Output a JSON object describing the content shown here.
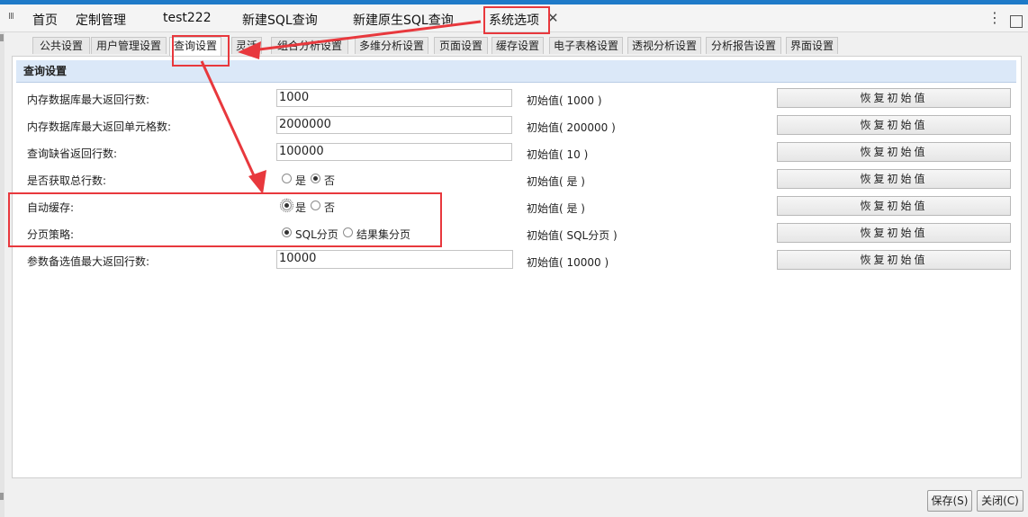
{
  "tabs": [
    {
      "label": "首页"
    },
    {
      "label": "定制管理"
    },
    {
      "label": "test222"
    },
    {
      "label": "新建SQL查询"
    },
    {
      "label": "新建原生SQL查询"
    },
    {
      "label": "系统选项",
      "close": "✕"
    }
  ],
  "window": {
    "grip": "III",
    "more": "⋮"
  },
  "subtabs": [
    {
      "label": "公共设置"
    },
    {
      "label": "用户管理设置"
    },
    {
      "label": "查询设置"
    },
    {
      "label": "灵活"
    },
    {
      "label": "组合分析设置"
    },
    {
      "label": "多维分析设置"
    },
    {
      "label": "页面设置"
    },
    {
      "label": "缓存设置"
    },
    {
      "label": "电子表格设置"
    },
    {
      "label": "透视分析设置"
    },
    {
      "label": "分析报告设置"
    },
    {
      "label": "界面设置"
    }
  ],
  "panel": {
    "title": "查询设置"
  },
  "settings": [
    {
      "label": "内存数据库最大返回行数:",
      "value": "1000",
      "initial": "初始值( 1000 )",
      "reset": "恢复初始值"
    },
    {
      "label": "内存数据库最大返回单元格数:",
      "value": "2000000",
      "initial": "初始值( 200000 )",
      "reset": "恢复初始值"
    },
    {
      "label": "查询缺省返回行数:",
      "value": "100000",
      "initial": "初始值( 10 )",
      "reset": "恢复初始值"
    },
    {
      "label": "是否获取总行数:",
      "opt1": "是",
      "opt2": "否",
      "selected": "否",
      "initial": "初始值( 是 )",
      "reset": "恢复初始值"
    },
    {
      "label": "自动缓存:",
      "opt1": "是",
      "opt2": "否",
      "selected": "是",
      "initial": "初始值( 是 )",
      "reset": "恢复初始值"
    },
    {
      "label": "分页策略:",
      "opt1": "SQL分页",
      "opt2": "结果集分页",
      "selected": "SQL分页",
      "initial": "初始值( SQL分页 )",
      "reset": "恢复初始值"
    },
    {
      "label": "参数备选值最大返回行数:",
      "value": "10000",
      "initial": "初始值( 10000 )",
      "reset": "恢复初始值"
    }
  ],
  "footer": {
    "save": "保存(S)",
    "close": "关闭(C)"
  },
  "colors": {
    "accent": "#1e7ac8",
    "highlight": "#e8383d",
    "panel_head": "#dbe8f8"
  }
}
